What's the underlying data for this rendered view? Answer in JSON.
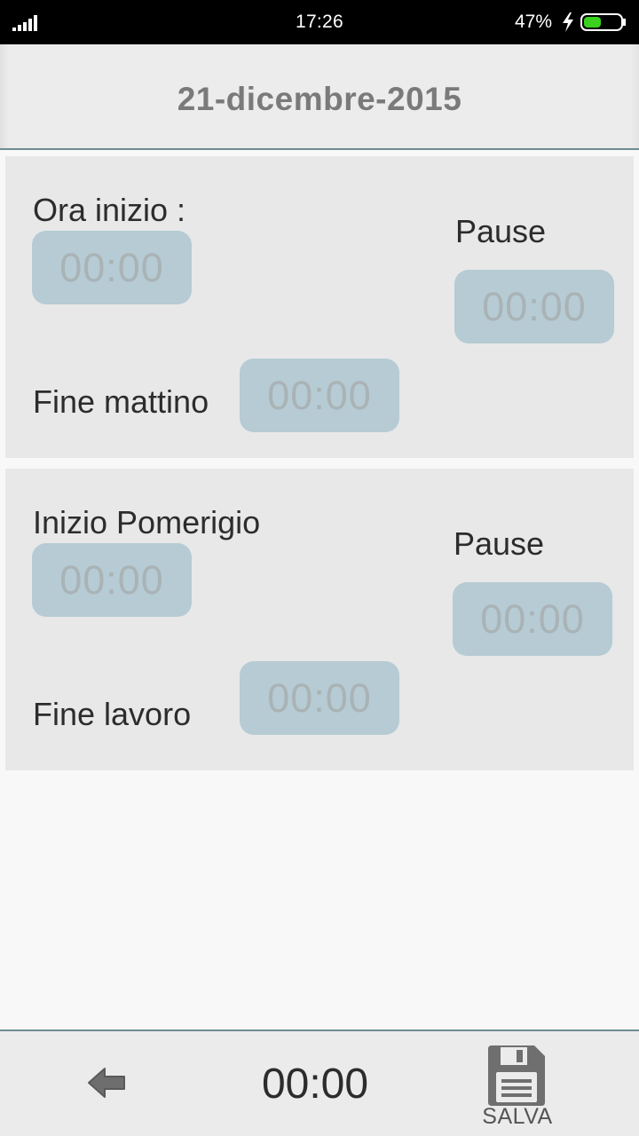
{
  "status_bar": {
    "time": "17:26",
    "battery_percent": "47%",
    "battery_level": 0.47,
    "icons": [
      "signal-icon",
      "charging-bolt-icon",
      "battery-icon"
    ]
  },
  "header": {
    "date": "21-dicembre-2015"
  },
  "morning": {
    "start_label": "Ora inizio :",
    "start_value": "00:00",
    "pause_label": "Pause",
    "pause_value": "00:00",
    "end_label": "Fine mattino",
    "end_value": "00:00"
  },
  "afternoon": {
    "start_label": "Inizio Pomerigio",
    "start_value": "00:00",
    "pause_label": "Pause",
    "pause_value": "00:00",
    "end_label": "Fine lavoro",
    "end_value": "00:00"
  },
  "bottom_bar": {
    "back_icon": "arrow-left-icon",
    "total": "00:00",
    "save_label": "SALVA",
    "save_icon": "floppy-disk-icon"
  },
  "colors": {
    "field_bg": "#b6cbd3",
    "field_text": "#a9b3b6",
    "card_bg": "#e8e8e8",
    "divider": "#6e8c92",
    "battery_green": "#3ad21f"
  }
}
